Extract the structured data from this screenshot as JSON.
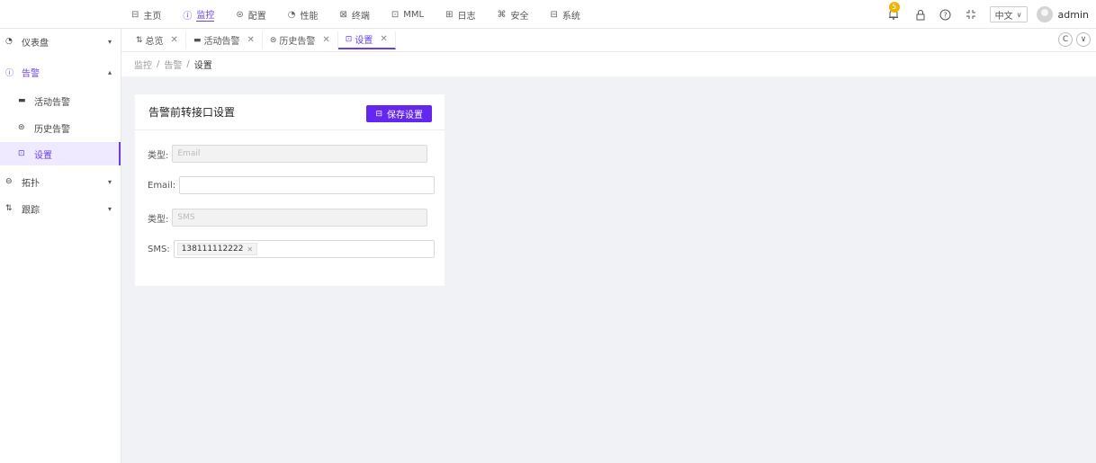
{
  "topnav": [
    {
      "icon": "home-icon",
      "glyph": "⊟",
      "label": "主页",
      "active": false
    },
    {
      "icon": "monitor-icon",
      "glyph": "ⓘ",
      "label": "监控",
      "active": true
    },
    {
      "icon": "config-icon",
      "glyph": "⊜",
      "label": "配置",
      "active": false
    },
    {
      "icon": "performance-icon",
      "glyph": "◔",
      "label": "性能",
      "active": false
    },
    {
      "icon": "terminal-icon",
      "glyph": "⊠",
      "label": "终端",
      "active": false
    },
    {
      "icon": "mml-icon",
      "glyph": "⊡",
      "label": "MML",
      "active": false
    },
    {
      "icon": "log-icon",
      "glyph": "⊞",
      "label": "日志",
      "active": false
    },
    {
      "icon": "security-icon",
      "glyph": "⌘",
      "label": "安全",
      "active": false
    },
    {
      "icon": "system-icon",
      "glyph": "⊟",
      "label": "系统",
      "active": false
    }
  ],
  "topright": {
    "notification_count": "5",
    "language": "中文",
    "username": "admin"
  },
  "sidebar": {
    "items": [
      {
        "label": "仪表盘"
      },
      {
        "label": "告警"
      },
      {
        "label": "活动告警"
      },
      {
        "label": "历史告警"
      },
      {
        "label": "设置"
      },
      {
        "label": "拓扑"
      },
      {
        "label": "跟踪"
      }
    ]
  },
  "tabs": [
    {
      "label": "总览"
    },
    {
      "label": "活动告警"
    },
    {
      "label": "历史告警"
    },
    {
      "label": "设置"
    }
  ],
  "breadcrumb": {
    "items": [
      "监控",
      "告警",
      "设置"
    ]
  },
  "card": {
    "title": "告警前转接口设置",
    "save_label": "保存设置",
    "type1_label": "类型:",
    "type1_value": "Email",
    "email_label": "Email:",
    "email_value": "",
    "type2_label": "类型:",
    "type2_value": "SMS",
    "sms_label": "SMS:",
    "sms_tag": "138111112222"
  },
  "colors": {
    "accent": "#6b3fe6",
    "button": "#6327ef",
    "content_bg": "#f0f2f5"
  }
}
